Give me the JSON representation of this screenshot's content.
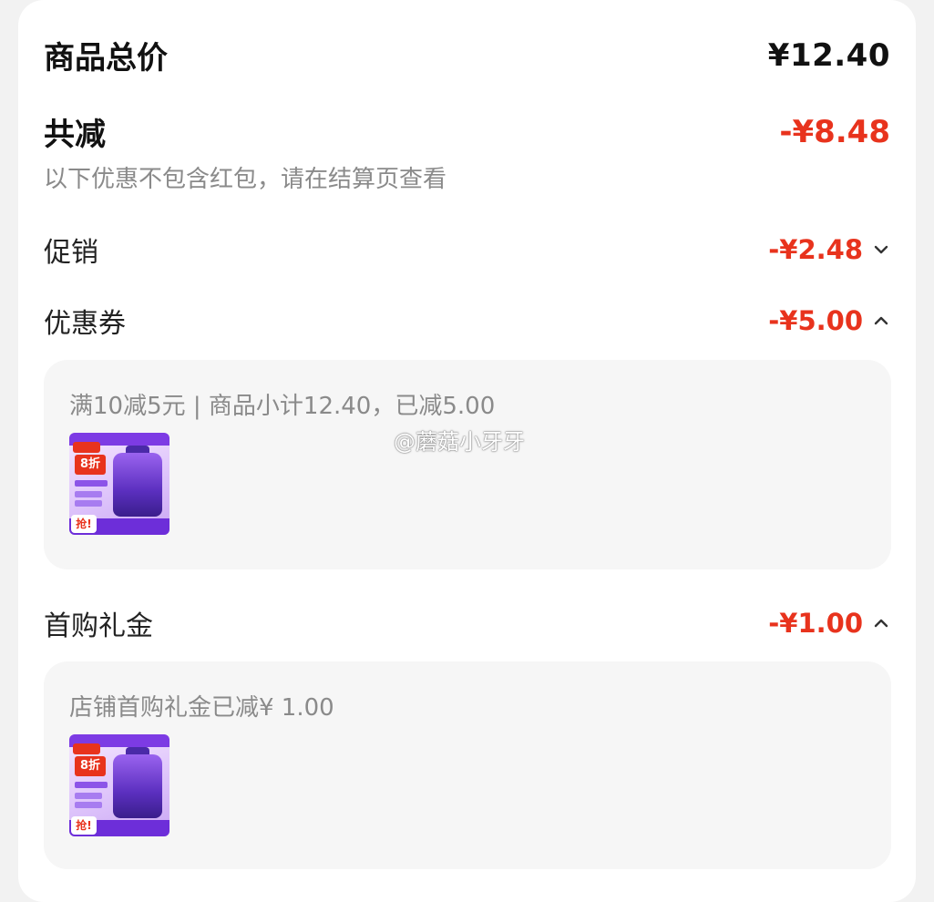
{
  "summary": {
    "total_label": "商品总价",
    "total_value": "¥12.40",
    "discount_label": "共减",
    "discount_value": "-¥8.48",
    "note": "以下优惠不包含红包，请在结算页查看"
  },
  "promotions": [
    {
      "label": "促销",
      "amount": "-¥2.48",
      "expanded": false
    },
    {
      "label": "优惠券",
      "amount": "-¥5.00",
      "expanded": true,
      "detail": "满10减5元 | 商品小计12.40，已减5.00",
      "product_badge": "8折",
      "product_tag": "抢!"
    },
    {
      "label": "首购礼金",
      "amount": "-¥1.00",
      "expanded": true,
      "detail": "店铺首购礼金已减¥ 1.00",
      "product_badge": "8折",
      "product_tag": "抢!"
    }
  ],
  "watermark": "@蘑菇小牙牙",
  "colors": {
    "discount_red": "#e8331d",
    "text_dark": "#111111",
    "text_gray": "#8a8a8a",
    "box_bg": "#f6f6f6"
  }
}
